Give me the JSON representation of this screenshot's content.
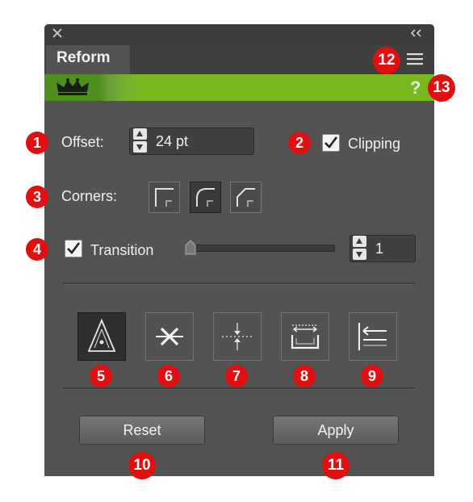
{
  "panel": {
    "tab_label": "Reform",
    "help_label": "?"
  },
  "offset": {
    "label": "Offset:",
    "value": "24 pt"
  },
  "clipping": {
    "label": "Clipping",
    "checked": true
  },
  "corners": {
    "label": "Corners:"
  },
  "transition": {
    "label": "Transition",
    "checked": true,
    "value": "1"
  },
  "buttons": {
    "reset": "Reset",
    "apply": "Apply"
  },
  "badges": [
    "1",
    "2",
    "3",
    "4",
    "5",
    "6",
    "7",
    "8",
    "9",
    "10",
    "11",
    "12",
    "13"
  ],
  "colors": {
    "accent_green": "#7ab81f",
    "badge_red": "#e10f0f",
    "panel_bg": "#535353"
  }
}
